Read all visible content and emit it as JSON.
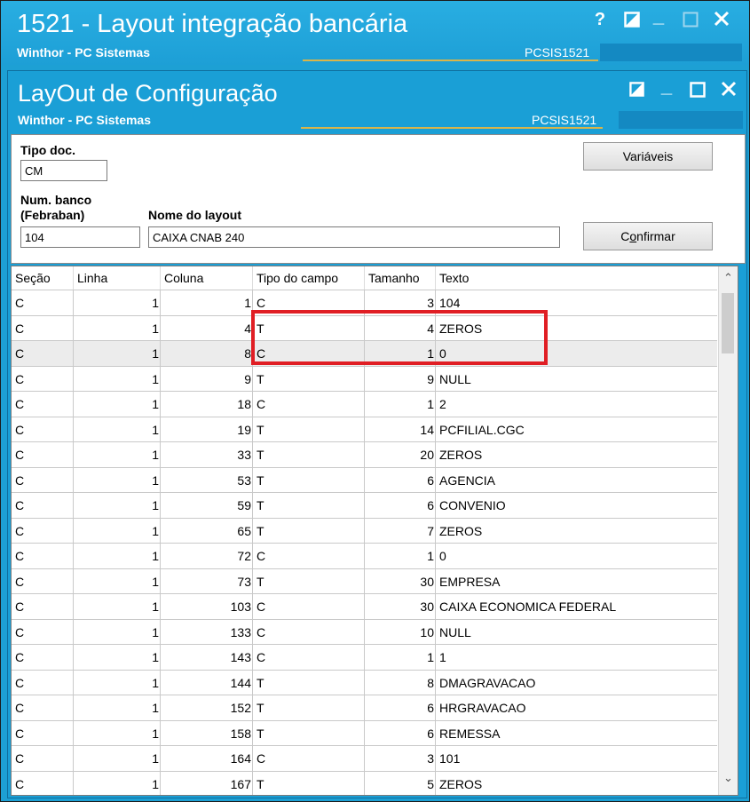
{
  "outer_window": {
    "title": "1521 - Layout integração bancária",
    "subtitle": "Winthor - PC Sistemas",
    "code": "PCSIS1521",
    "help_btn": "?",
    "min_btn": "_"
  },
  "dialog": {
    "title": "LayOut de Configuração",
    "subtitle": "Winthor - PC Sistemas",
    "code": "PCSIS1521",
    "min_btn": "_"
  },
  "form": {
    "tipo_doc_label": "Tipo doc.",
    "tipo_doc_value": "CM",
    "num_banco_label_1": "Num. banco",
    "num_banco_label_2": "(Febraban)",
    "num_banco_value": "104",
    "nome_layout_label": "Nome do layout",
    "nome_layout_value": "CAIXA CNAB 240",
    "variaveis_btn": "Variáveis",
    "confirmar_btn_pre": "C",
    "confirmar_btn_ul": "o",
    "confirmar_btn_post": "nfirmar"
  },
  "grid": {
    "columns": [
      "Seção",
      "Linha",
      "Coluna",
      "Tipo do campo",
      "Tamanho",
      "Texto"
    ],
    "rows": [
      [
        "C",
        "1",
        "1",
        "C",
        "3",
        "104"
      ],
      [
        "C",
        "1",
        "4",
        "T",
        "4",
        "ZEROS"
      ],
      [
        "C",
        "1",
        "8",
        "C",
        "1",
        "0"
      ],
      [
        "C",
        "1",
        "9",
        "T",
        "9",
        "NULL"
      ],
      [
        "C",
        "1",
        "18",
        "C",
        "1",
        "2"
      ],
      [
        "C",
        "1",
        "19",
        "T",
        "14",
        "PCFILIAL.CGC"
      ],
      [
        "C",
        "1",
        "33",
        "T",
        "20",
        "ZEROS"
      ],
      [
        "C",
        "1",
        "53",
        "T",
        "6",
        "AGENCIA"
      ],
      [
        "C",
        "1",
        "59",
        "T",
        "6",
        "CONVENIO"
      ],
      [
        "C",
        "1",
        "65",
        "T",
        "7",
        "ZEROS"
      ],
      [
        "C",
        "1",
        "72",
        "C",
        "1",
        "0"
      ],
      [
        "C",
        "1",
        "73",
        "T",
        "30",
        "EMPRESA"
      ],
      [
        "C",
        "1",
        "103",
        "C",
        "30",
        "CAIXA ECONOMICA FEDERAL"
      ],
      [
        "C",
        "1",
        "133",
        "C",
        "10",
        "NULL"
      ],
      [
        "C",
        "1",
        "143",
        "C",
        "1",
        "1"
      ],
      [
        "C",
        "1",
        "144",
        "T",
        "8",
        "DMAGRAVACAO"
      ],
      [
        "C",
        "1",
        "152",
        "T",
        "6",
        "HRGRAVACAO"
      ],
      [
        "C",
        "1",
        "158",
        "T",
        "6",
        "REMESSA"
      ],
      [
        "C",
        "1",
        "164",
        "C",
        "3",
        "101"
      ],
      [
        "C",
        "1",
        "167",
        "T",
        "5",
        "ZEROS"
      ]
    ],
    "selected_row": 2,
    "scroll_up": "⌃",
    "scroll_down": "⌄"
  },
  "colors": {
    "titlebar": "#1da0d4",
    "highlight": "#e01e24",
    "accent_line": "#d9b54a"
  }
}
